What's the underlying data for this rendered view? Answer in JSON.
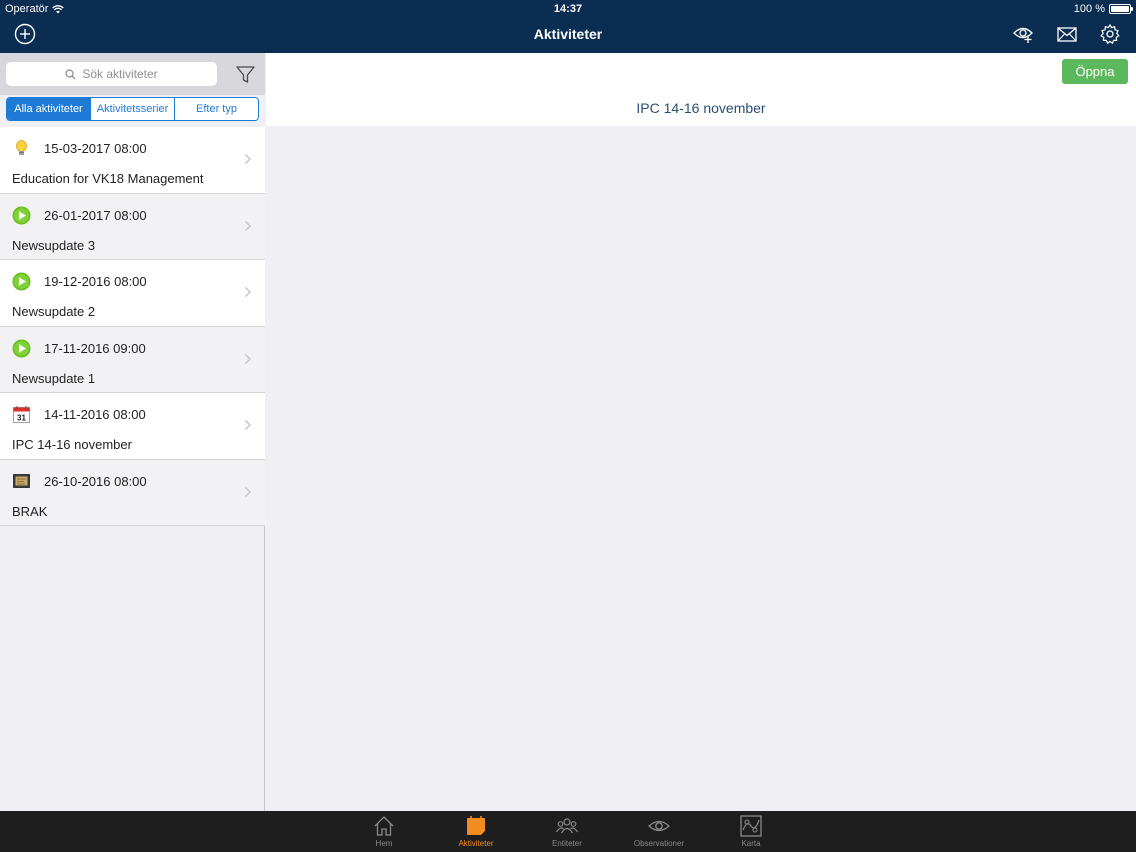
{
  "status_bar": {
    "carrier": "Operatör",
    "time": "14:37",
    "battery": "100 %"
  },
  "nav": {
    "title": "Aktiviteter"
  },
  "search": {
    "placeholder": "Sök aktiviteter"
  },
  "segments": [
    "Alla aktiviteter",
    "Aktivitetsserier",
    "Efter typ"
  ],
  "activities": [
    {
      "icon": "lightbulb-icon",
      "date": "15-03-2017 08:00",
      "title": "Education for VK18 Management"
    },
    {
      "icon": "play-icon",
      "date": "26-01-2017 08:00",
      "title": "Newsupdate 3"
    },
    {
      "icon": "play-icon",
      "date": "19-12-2016 08:00",
      "title": "Newsupdate 2"
    },
    {
      "icon": "play-icon",
      "date": "17-11-2016 09:00",
      "title": "Newsupdate 1"
    },
    {
      "icon": "calendar-icon",
      "date": "14-11-2016 08:00",
      "title": "IPC 14-16 november",
      "calendar_day": "31"
    },
    {
      "icon": "board-icon",
      "date": "26-10-2016 08:00",
      "title": "BRAK"
    }
  ],
  "detail": {
    "open_button": "Öppna",
    "title": "IPC 14-16 november"
  },
  "tabs": [
    {
      "label": "Hem",
      "icon": "home-icon"
    },
    {
      "label": "Aktiviteter",
      "icon": "calendar-tab-icon"
    },
    {
      "label": "Entiteter",
      "icon": "people-icon"
    },
    {
      "label": "Observationer",
      "icon": "eye-icon"
    },
    {
      "label": "Karta",
      "icon": "map-icon"
    }
  ],
  "colors": {
    "nav_bg": "#0b2d52",
    "accent_blue": "#1f7ad6",
    "open_green": "#5cb85c",
    "tab_active": "#f28c1e"
  }
}
